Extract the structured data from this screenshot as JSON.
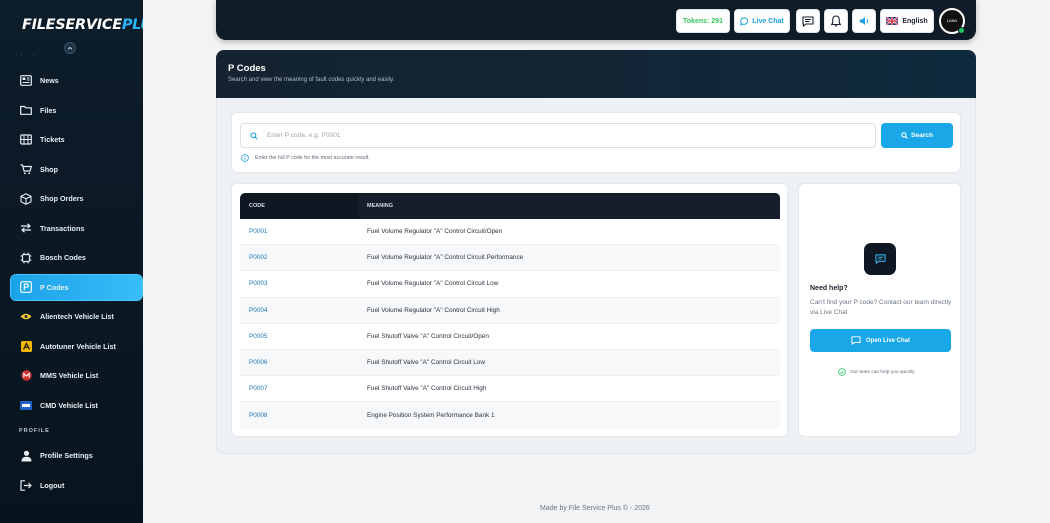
{
  "brand": {
    "name_part1": "FILESERVICE",
    "name_part2": "PLUS"
  },
  "sidebar": {
    "items": [
      {
        "label": "News",
        "icon": "news-icon"
      },
      {
        "label": "Files",
        "icon": "folder-icon"
      },
      {
        "label": "Tickets",
        "icon": "ticket-icon"
      },
      {
        "label": "Shop",
        "icon": "cart-icon"
      },
      {
        "label": "Shop Orders",
        "icon": "box-icon"
      },
      {
        "label": "Transactions",
        "icon": "exchange-icon"
      },
      {
        "label": "Bosch Codes",
        "icon": "chip-icon"
      },
      {
        "label": "P Codes",
        "icon": "p-code-icon",
        "active": true
      },
      {
        "label": "Alientech Vehicle List",
        "icon": "alientech-logo-icon"
      },
      {
        "label": "Autotuner Vehicle List",
        "icon": "autotuner-logo-icon"
      },
      {
        "label": "MMS Vehicle List",
        "icon": "mms-logo-icon"
      },
      {
        "label": "CMD Vehicle List",
        "icon": "cmd-logo-icon"
      }
    ],
    "section_profile": "PROFILE",
    "profile_items": [
      {
        "label": "Profile Settings",
        "icon": "user-icon"
      },
      {
        "label": "Logout",
        "icon": "logout-icon"
      }
    ]
  },
  "topbar": {
    "tokens_label": "Tokens: 291",
    "live_chat_label": "Live Chat",
    "language_label": "English",
    "avatar_text": "LOGO"
  },
  "page": {
    "title": "P Codes",
    "subtitle": "Search and view the meaning of fault codes quickly and easily."
  },
  "search": {
    "placeholder": "Enter P code, e.g. P0001",
    "button_label": "Search",
    "hint": "Enter the full P code for the most accurate result."
  },
  "table": {
    "headers": [
      "CODE",
      "MEANING"
    ],
    "rows": [
      {
        "code": "P0001",
        "meaning": "Fuel Volume Regulator \"A\" Control Circuit/Open"
      },
      {
        "code": "P0002",
        "meaning": "Fuel Volume Regulator \"A\" Control Circuit Performance"
      },
      {
        "code": "P0003",
        "meaning": "Fuel Volume Regulator \"A\" Control Circuit Low"
      },
      {
        "code": "P0004",
        "meaning": "Fuel Volume Regulator \"A\" Control Circuit High"
      },
      {
        "code": "P0005",
        "meaning": "Fuel Shutoff Valve \"A\" Control Circuit/Open"
      },
      {
        "code": "P0006",
        "meaning": "Fuel Shutoff Valve \"A\" Control Circuit Low"
      },
      {
        "code": "P0007",
        "meaning": "Fuel Shutoff Valve \"A\" Control Circuit High"
      },
      {
        "code": "P0008",
        "meaning": "Engine Position System Performance Bank 1"
      }
    ]
  },
  "help": {
    "title": "Need help?",
    "text": "Can't find your P code? Contact our team directly via Live Chat",
    "button_label": "Open Live Chat",
    "note": "Our team can help you quickly"
  },
  "footer": {
    "text": "Made by File Service Plus © - 2026"
  },
  "colors": {
    "accent": "#1aa7e8",
    "sidebar_bg": "#0c1c29",
    "tokens": "#35c759"
  }
}
